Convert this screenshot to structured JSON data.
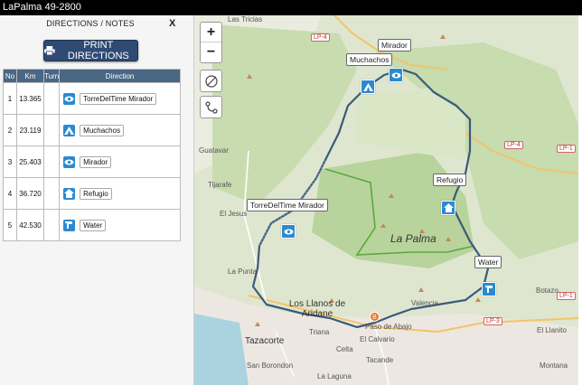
{
  "window": {
    "title": "LaPalma 49-2800"
  },
  "panel": {
    "header": "DIRECTIONS / NOTES",
    "close_label": "X",
    "print_label": "PRINT DIRECTIONS",
    "columns": [
      "No",
      "Km",
      "Turn",
      "Direction"
    ],
    "rows": [
      {
        "no": "1",
        "km": "13.365",
        "icon": "eye-icon",
        "label": "TorreDelTime Mirador"
      },
      {
        "no": "2",
        "km": "23.119",
        "icon": "camp-icon",
        "label": "Muchachos"
      },
      {
        "no": "3",
        "km": "25.403",
        "icon": "eye-icon",
        "label": "Mirador"
      },
      {
        "no": "4",
        "km": "36.720",
        "icon": "home-icon",
        "label": "Refugio"
      },
      {
        "no": "5",
        "km": "42.530",
        "icon": "water-icon",
        "label": "Water"
      }
    ]
  },
  "map": {
    "zoom_in": "+",
    "zoom_out": "−",
    "callouts": {
      "mirador": "Mirador",
      "muchachos": "Muchachos",
      "refugio": "Refugio",
      "torre": "TorreDelTime Mirador",
      "water": "Water"
    },
    "roads": {
      "lp4a": "LP-4",
      "lp4b": "LP-4",
      "lp3": "LP-3",
      "lp1": "LP-1",
      "lp1b": "LP-1"
    },
    "places": {
      "tricias": "Las Tricias",
      "guatavar": "Guatavar",
      "tijarafe": "Tijarafe",
      "eljesus": "El Jesus",
      "lapunta": "La Punta",
      "lapalma": "La Palma",
      "llanos": "Los Llanos de Aridane",
      "paso": "Paso de Abajo",
      "valencia": "Valencia",
      "elcalvario": "El Calvario",
      "triana": "Triana",
      "celta": "Celta",
      "tazacorte": "Tazacorte",
      "tacande": "Tacande",
      "borondon": "San Borondon",
      "laguna": "La Laguna",
      "botazo": "Botazo",
      "elllanito": "El Llanito",
      "montana": "Montana"
    },
    "route_marker_b": "B"
  },
  "colors": {
    "header_bg": "#4a6784",
    "button_bg": "#2f4a73",
    "icon_blue": "#2a8ad0",
    "route": "#3a5a7a",
    "park_border": "#5aa83c"
  }
}
